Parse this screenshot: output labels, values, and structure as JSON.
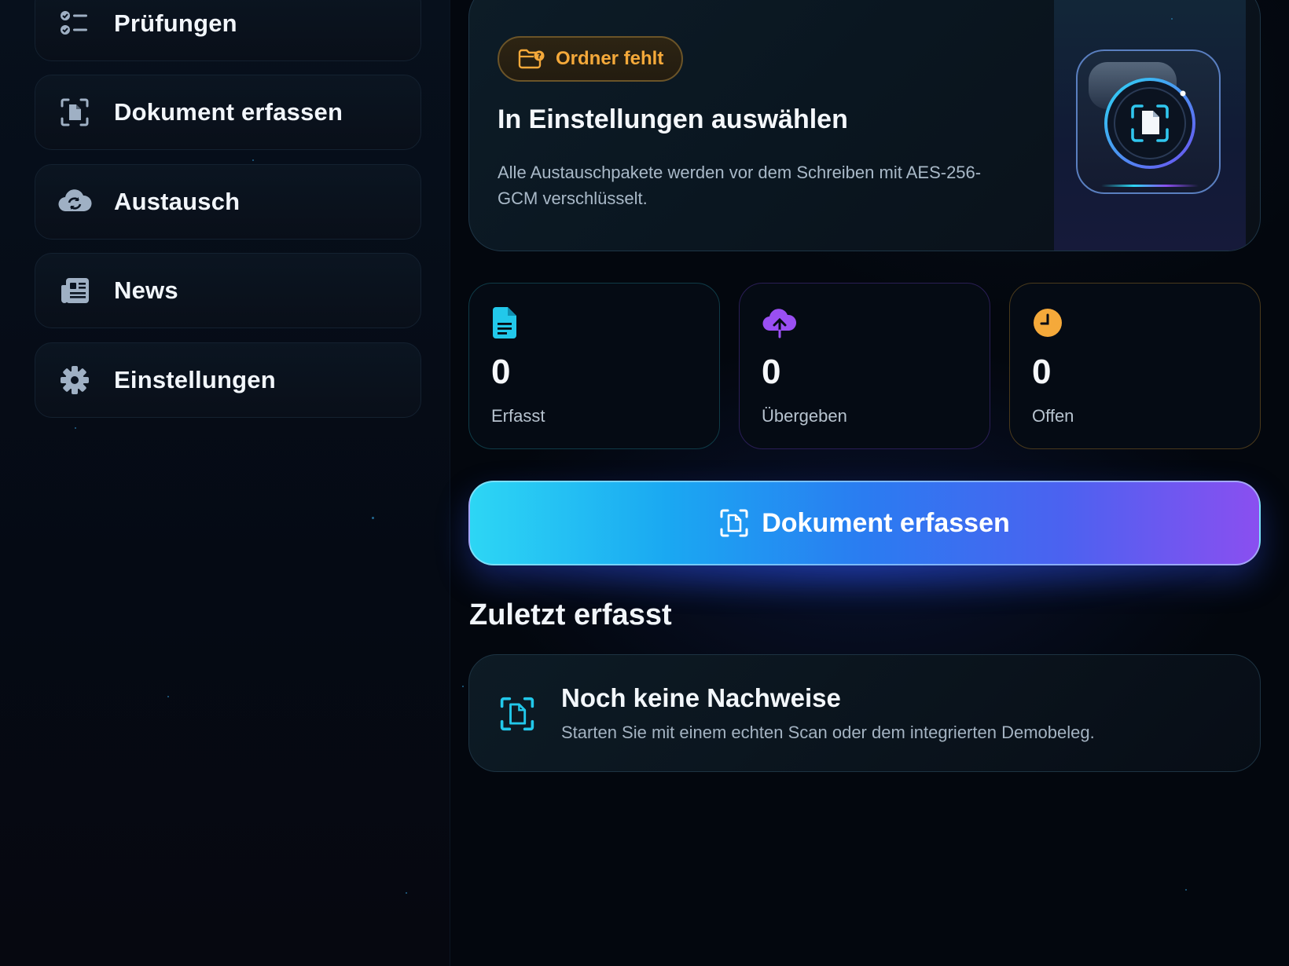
{
  "sidebar": {
    "items": [
      {
        "label": "Prüfungen",
        "icon": "checklist-icon"
      },
      {
        "label": "Dokument erfassen",
        "icon": "document-scan-icon"
      },
      {
        "label": "Austausch",
        "icon": "cloud-sync-icon"
      },
      {
        "label": "News",
        "icon": "newspaper-icon"
      },
      {
        "label": "Einstellungen",
        "icon": "gear-icon"
      }
    ]
  },
  "hero": {
    "badge": "Ordner fehlt",
    "badge_icon": "folder-question-icon",
    "title": "In Einstellungen auswählen",
    "description": "Alle Austauschpakete werden vor dem Schreiben mit AES-256-GCM verschlüsselt.",
    "art_icon": "document-scan-icon"
  },
  "stats": [
    {
      "value": "0",
      "label": "Erfasst",
      "icon": "document-icon",
      "color": "#22c8ea"
    },
    {
      "value": "0",
      "label": "Übergeben",
      "icon": "cloud-upload-icon",
      "color": "#9a4ff2"
    },
    {
      "value": "0",
      "label": "Offen",
      "icon": "clock-icon",
      "color": "#f5a93a"
    }
  ],
  "primary_action": {
    "label": "Dokument erfassen",
    "icon": "document-scan-icon"
  },
  "recent": {
    "title": "Zuletzt erfasst",
    "empty_title": "Noch keine Nachweise",
    "empty_description": "Starten Sie mit einem echten Scan oder dem integrierten Demobeleg.",
    "empty_icon": "document-scan-icon"
  },
  "colors": {
    "background": "#03070e",
    "accent_cyan": "#22c8ea",
    "accent_purple": "#9a4ff2",
    "accent_orange": "#f5a93a"
  }
}
